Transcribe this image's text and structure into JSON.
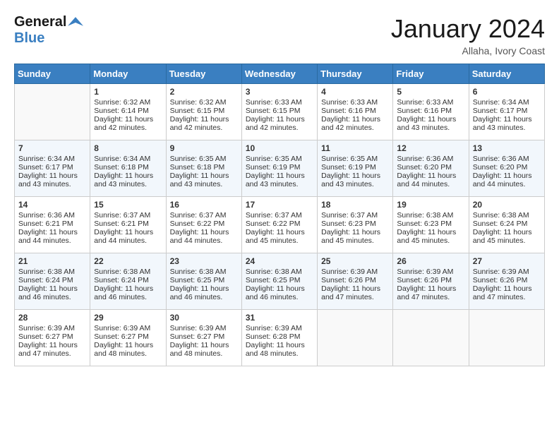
{
  "header": {
    "logo_line1": "General",
    "logo_line2": "Blue",
    "month_title": "January 2024",
    "location": "Allaha, Ivory Coast"
  },
  "days_of_week": [
    "Sunday",
    "Monday",
    "Tuesday",
    "Wednesday",
    "Thursday",
    "Friday",
    "Saturday"
  ],
  "weeks": [
    [
      {
        "day": "",
        "sunrise": "",
        "sunset": "",
        "daylight": ""
      },
      {
        "day": "1",
        "sunrise": "Sunrise: 6:32 AM",
        "sunset": "Sunset: 6:14 PM",
        "daylight": "Daylight: 11 hours and 42 minutes."
      },
      {
        "day": "2",
        "sunrise": "Sunrise: 6:32 AM",
        "sunset": "Sunset: 6:15 PM",
        "daylight": "Daylight: 11 hours and 42 minutes."
      },
      {
        "day": "3",
        "sunrise": "Sunrise: 6:33 AM",
        "sunset": "Sunset: 6:15 PM",
        "daylight": "Daylight: 11 hours and 42 minutes."
      },
      {
        "day": "4",
        "sunrise": "Sunrise: 6:33 AM",
        "sunset": "Sunset: 6:16 PM",
        "daylight": "Daylight: 11 hours and 42 minutes."
      },
      {
        "day": "5",
        "sunrise": "Sunrise: 6:33 AM",
        "sunset": "Sunset: 6:16 PM",
        "daylight": "Daylight: 11 hours and 43 minutes."
      },
      {
        "day": "6",
        "sunrise": "Sunrise: 6:34 AM",
        "sunset": "Sunset: 6:17 PM",
        "daylight": "Daylight: 11 hours and 43 minutes."
      }
    ],
    [
      {
        "day": "7",
        "sunrise": "Sunrise: 6:34 AM",
        "sunset": "Sunset: 6:17 PM",
        "daylight": "Daylight: 11 hours and 43 minutes."
      },
      {
        "day": "8",
        "sunrise": "Sunrise: 6:34 AM",
        "sunset": "Sunset: 6:18 PM",
        "daylight": "Daylight: 11 hours and 43 minutes."
      },
      {
        "day": "9",
        "sunrise": "Sunrise: 6:35 AM",
        "sunset": "Sunset: 6:18 PM",
        "daylight": "Daylight: 11 hours and 43 minutes."
      },
      {
        "day": "10",
        "sunrise": "Sunrise: 6:35 AM",
        "sunset": "Sunset: 6:19 PM",
        "daylight": "Daylight: 11 hours and 43 minutes."
      },
      {
        "day": "11",
        "sunrise": "Sunrise: 6:35 AM",
        "sunset": "Sunset: 6:19 PM",
        "daylight": "Daylight: 11 hours and 43 minutes."
      },
      {
        "day": "12",
        "sunrise": "Sunrise: 6:36 AM",
        "sunset": "Sunset: 6:20 PM",
        "daylight": "Daylight: 11 hours and 44 minutes."
      },
      {
        "day": "13",
        "sunrise": "Sunrise: 6:36 AM",
        "sunset": "Sunset: 6:20 PM",
        "daylight": "Daylight: 11 hours and 44 minutes."
      }
    ],
    [
      {
        "day": "14",
        "sunrise": "Sunrise: 6:36 AM",
        "sunset": "Sunset: 6:21 PM",
        "daylight": "Daylight: 11 hours and 44 minutes."
      },
      {
        "day": "15",
        "sunrise": "Sunrise: 6:37 AM",
        "sunset": "Sunset: 6:21 PM",
        "daylight": "Daylight: 11 hours and 44 minutes."
      },
      {
        "day": "16",
        "sunrise": "Sunrise: 6:37 AM",
        "sunset": "Sunset: 6:22 PM",
        "daylight": "Daylight: 11 hours and 44 minutes."
      },
      {
        "day": "17",
        "sunrise": "Sunrise: 6:37 AM",
        "sunset": "Sunset: 6:22 PM",
        "daylight": "Daylight: 11 hours and 45 minutes."
      },
      {
        "day": "18",
        "sunrise": "Sunrise: 6:37 AM",
        "sunset": "Sunset: 6:23 PM",
        "daylight": "Daylight: 11 hours and 45 minutes."
      },
      {
        "day": "19",
        "sunrise": "Sunrise: 6:38 AM",
        "sunset": "Sunset: 6:23 PM",
        "daylight": "Daylight: 11 hours and 45 minutes."
      },
      {
        "day": "20",
        "sunrise": "Sunrise: 6:38 AM",
        "sunset": "Sunset: 6:24 PM",
        "daylight": "Daylight: 11 hours and 45 minutes."
      }
    ],
    [
      {
        "day": "21",
        "sunrise": "Sunrise: 6:38 AM",
        "sunset": "Sunset: 6:24 PM",
        "daylight": "Daylight: 11 hours and 46 minutes."
      },
      {
        "day": "22",
        "sunrise": "Sunrise: 6:38 AM",
        "sunset": "Sunset: 6:24 PM",
        "daylight": "Daylight: 11 hours and 46 minutes."
      },
      {
        "day": "23",
        "sunrise": "Sunrise: 6:38 AM",
        "sunset": "Sunset: 6:25 PM",
        "daylight": "Daylight: 11 hours and 46 minutes."
      },
      {
        "day": "24",
        "sunrise": "Sunrise: 6:38 AM",
        "sunset": "Sunset: 6:25 PM",
        "daylight": "Daylight: 11 hours and 46 minutes."
      },
      {
        "day": "25",
        "sunrise": "Sunrise: 6:39 AM",
        "sunset": "Sunset: 6:26 PM",
        "daylight": "Daylight: 11 hours and 47 minutes."
      },
      {
        "day": "26",
        "sunrise": "Sunrise: 6:39 AM",
        "sunset": "Sunset: 6:26 PM",
        "daylight": "Daylight: 11 hours and 47 minutes."
      },
      {
        "day": "27",
        "sunrise": "Sunrise: 6:39 AM",
        "sunset": "Sunset: 6:26 PM",
        "daylight": "Daylight: 11 hours and 47 minutes."
      }
    ],
    [
      {
        "day": "28",
        "sunrise": "Sunrise: 6:39 AM",
        "sunset": "Sunset: 6:27 PM",
        "daylight": "Daylight: 11 hours and 47 minutes."
      },
      {
        "day": "29",
        "sunrise": "Sunrise: 6:39 AM",
        "sunset": "Sunset: 6:27 PM",
        "daylight": "Daylight: 11 hours and 48 minutes."
      },
      {
        "day": "30",
        "sunrise": "Sunrise: 6:39 AM",
        "sunset": "Sunset: 6:27 PM",
        "daylight": "Daylight: 11 hours and 48 minutes."
      },
      {
        "day": "31",
        "sunrise": "Sunrise: 6:39 AM",
        "sunset": "Sunset: 6:28 PM",
        "daylight": "Daylight: 11 hours and 48 minutes."
      },
      {
        "day": "",
        "sunrise": "",
        "sunset": "",
        "daylight": ""
      },
      {
        "day": "",
        "sunrise": "",
        "sunset": "",
        "daylight": ""
      },
      {
        "day": "",
        "sunrise": "",
        "sunset": "",
        "daylight": ""
      }
    ]
  ]
}
